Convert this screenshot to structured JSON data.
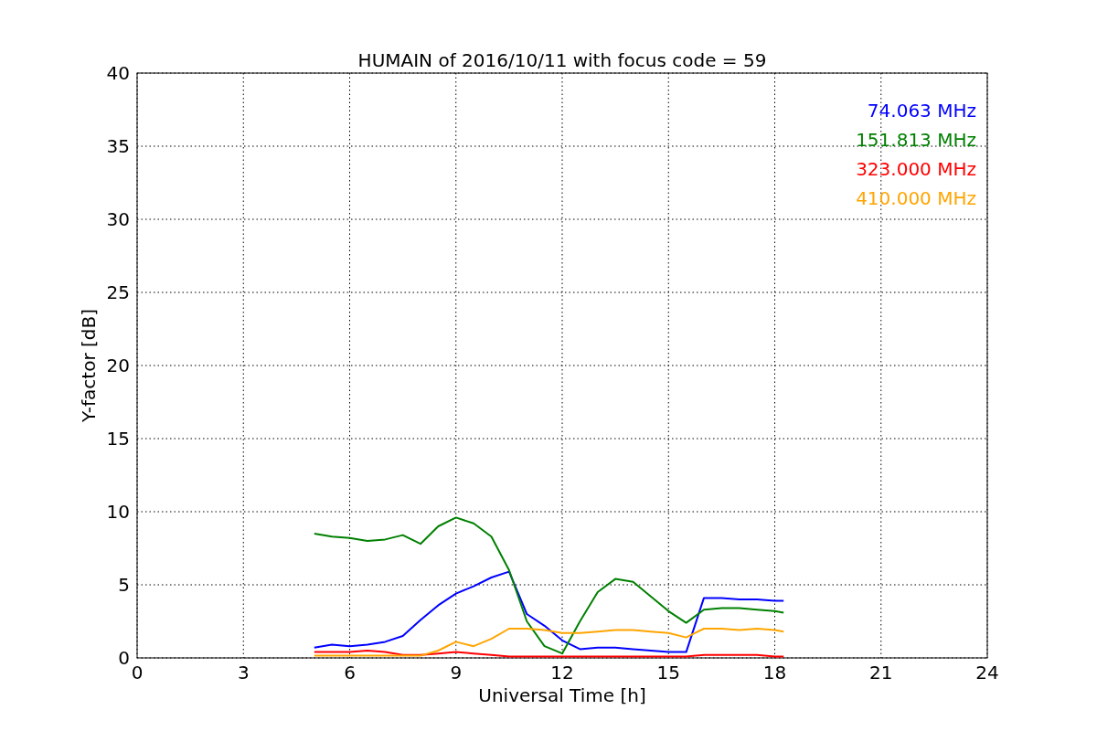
{
  "chart_data": {
    "type": "line",
    "title": "HUMAIN of 2016/10/11 with focus code = 59",
    "xlabel": "Universal Time [h]",
    "ylabel": "Y-factor [dB]",
    "xlim": [
      0,
      24
    ],
    "ylim": [
      0,
      40
    ],
    "xticks": [
      0,
      3,
      6,
      9,
      12,
      15,
      18,
      21,
      24
    ],
    "yticks": [
      0,
      5,
      10,
      15,
      20,
      25,
      30,
      35,
      40
    ],
    "grid": true,
    "x": [
      5,
      5.5,
      6,
      6.5,
      7,
      7.5,
      8,
      8.5,
      9,
      9.5,
      10,
      10.5,
      11,
      11.5,
      12,
      12.5,
      13,
      13.5,
      14,
      14.5,
      15,
      15.5,
      16,
      16.5,
      17,
      17.5,
      18,
      18.25
    ],
    "series": [
      {
        "name": "74.063 MHz",
        "color": "#0000ff",
        "values": [
          0.7,
          0.9,
          0.8,
          0.9,
          1.1,
          1.5,
          2.6,
          3.6,
          4.4,
          4.9,
          5.5,
          5.9,
          3.0,
          2.2,
          1.2,
          0.6,
          0.7,
          0.7,
          0.6,
          0.5,
          0.4,
          0.4,
          4.1,
          4.1,
          4.0,
          4.0,
          3.9,
          3.9
        ]
      },
      {
        "name": "151.813 MHz",
        "color": "#008000",
        "values": [
          8.5,
          8.3,
          8.2,
          8.0,
          8.1,
          8.4,
          7.8,
          9.0,
          9.6,
          9.2,
          8.3,
          6.0,
          2.5,
          0.8,
          0.3,
          2.5,
          4.5,
          5.4,
          5.2,
          4.2,
          3.2,
          2.4,
          3.3,
          3.4,
          3.4,
          3.3,
          3.2,
          3.1
        ]
      },
      {
        "name": "323.000 MHz",
        "color": "#ff0000",
        "values": [
          0.4,
          0.4,
          0.4,
          0.5,
          0.4,
          0.2,
          0.2,
          0.3,
          0.4,
          0.3,
          0.2,
          0.1,
          0.1,
          0.1,
          0.1,
          0.1,
          0.1,
          0.1,
          0.1,
          0.1,
          0.1,
          0.1,
          0.2,
          0.2,
          0.2,
          0.2,
          0.1,
          0.1
        ]
      },
      {
        "name": "410.000 MHz",
        "color": "#ffa500",
        "values": [
          0.15,
          0.15,
          0.15,
          0.15,
          0.15,
          0.15,
          0.15,
          0.5,
          1.1,
          0.8,
          1.3,
          2.0,
          2.0,
          1.9,
          1.7,
          1.7,
          1.8,
          1.9,
          1.9,
          1.8,
          1.7,
          1.4,
          2.0,
          2.0,
          1.9,
          2.0,
          1.9,
          1.8
        ]
      }
    ]
  }
}
